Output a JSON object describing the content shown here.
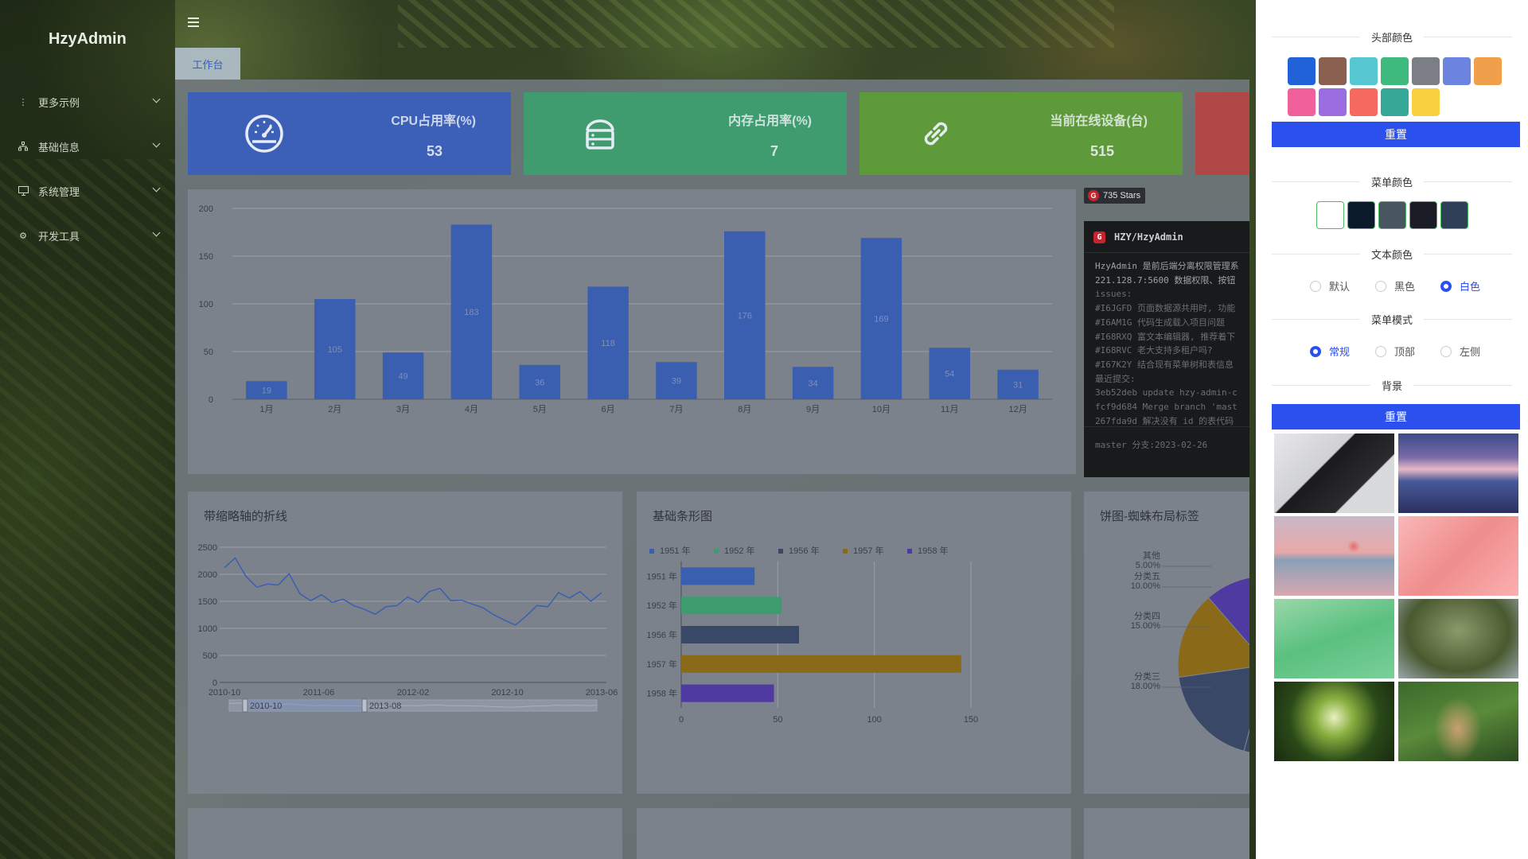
{
  "app": {
    "brand": "HzyAdmin"
  },
  "sidebar": {
    "items": [
      {
        "label": "更多示例",
        "icon": "more-icon"
      },
      {
        "label": "基础信息",
        "icon": "sitemap-icon"
      },
      {
        "label": "系统管理",
        "icon": "desktop-icon"
      },
      {
        "label": "开发工具",
        "icon": "gear-icon"
      }
    ]
  },
  "tabs": [
    {
      "label": "工作台",
      "active": true
    }
  ],
  "stats": [
    {
      "title": "CPU占用率(%)",
      "value": "53",
      "color": "#3c5fb8",
      "icon": "gauge-icon"
    },
    {
      "title": "内存占用率(%)",
      "value": "7",
      "color": "#3f9c6e",
      "icon": "server-icon"
    },
    {
      "title": "当前在线设备(台)",
      "value": "515",
      "color": "#5f9a3a",
      "icon": "link-icon"
    },
    {
      "title": "",
      "value": "",
      "color": "#b04848",
      "icon": ""
    }
  ],
  "bar_chart": {
    "chart_data": {
      "type": "bar",
      "categories": [
        "1月",
        "2月",
        "3月",
        "4月",
        "5月",
        "6月",
        "7月",
        "8月",
        "9月",
        "10月",
        "11月",
        "12月"
      ],
      "values": [
        19,
        105,
        49,
        183,
        36,
        118,
        39,
        176,
        34,
        169,
        54,
        31
      ],
      "ylim": [
        0,
        200
      ],
      "yticks": [
        "0",
        "50",
        "100",
        "150",
        "200"
      ],
      "color": "#3a5fb0"
    }
  },
  "git": {
    "stars": "735 Stars",
    "repo": "HZY/HzyAdmin",
    "lines": [
      "HzyAdmin 是前后端分离权限管理系",
      "221.128.7:5600 数据权限、按钮",
      "issues:",
      "#I6JGFD 页面数据源共用时, 功能",
      "#I6AM1G 代码生成载入项目问题",
      "#I68RXQ 富文本编辑器, 推荐着下",
      "#I68RVC 老大支持多租户吗?",
      "#I67K2Y 结合现有菜单树和表信息",
      "最近提交:",
      "3eb52deb update hzy-admin-c",
      "fcf9d684 Merge branch 'mast",
      "267fda9d 解决没有 id 的表代码"
    ],
    "footer": "master 分支:2023-02-26"
  },
  "line_panel": {
    "title": "带缩略轴的折线",
    "chart_data": {
      "type": "line",
      "x_ticks": [
        "2010-10",
        "2011-06",
        "2012-02",
        "2012-10",
        "2013-06"
      ],
      "ylim": [
        0,
        2500
      ],
      "yticks": [
        "0",
        "500",
        "1000",
        "1500",
        "2000",
        "2500"
      ],
      "values": [
        2120,
        2300,
        1960,
        1760,
        1820,
        1800,
        2010,
        1640,
        1510,
        1620,
        1480,
        1540,
        1420,
        1350,
        1260,
        1400,
        1420,
        1580,
        1480,
        1680,
        1740,
        1510,
        1520,
        1450,
        1380,
        1250,
        1150,
        1060,
        1230,
        1420,
        1400,
        1660,
        1560,
        1680,
        1500,
        1660
      ],
      "dataZoom": {
        "start": "2010-10",
        "end": "2013-08"
      },
      "color": "#3a5fb0"
    }
  },
  "hbar_panel": {
    "title": "基础条形图",
    "chart_data": {
      "type": "bar",
      "orientation": "horizontal",
      "categories": [
        "1951 年",
        "1952 年",
        "1956 年",
        "1957 年",
        "1958 年"
      ],
      "values": [
        38,
        52,
        61,
        145,
        48
      ],
      "colors": [
        "#3a5fb0",
        "#3f9c6e",
        "#3a4868",
        "#8a6a18",
        "#4e3aa0"
      ],
      "legend": [
        "1951 年",
        "1952 年",
        "1956 年",
        "1957 年",
        "1958 年"
      ],
      "xlim": [
        0,
        150
      ],
      "xticks": [
        "0",
        "50",
        "100",
        "150"
      ]
    }
  },
  "pie_panel": {
    "title": "饼图-蜘蛛布局标签",
    "chart_data": {
      "type": "pie",
      "labels": [
        {
          "name": "其他",
          "pct": "5.00%"
        },
        {
          "name": "分类五",
          "pct": "10.00%"
        },
        {
          "name": "分类四",
          "pct": "15.00%"
        },
        {
          "name": "分类三",
          "pct": "18.00%"
        }
      ],
      "colors": [
        "#3a7f9a",
        "#4e3aa0",
        "#8a6a18",
        "#3a4868"
      ]
    }
  },
  "settings": {
    "header_color_title": "头部颜色",
    "header_colors": [
      "#2262d8",
      "#8a6050",
      "#56c6d0",
      "#3fba7e",
      "#7b7f85",
      "#6c84e0",
      "#f0a04a",
      "#f0609a",
      "#9a6ee0",
      "#f56a5e",
      "#36a898",
      "#f8d040"
    ],
    "reset_label": "重置",
    "menu_color_title": "菜单颜色",
    "menu_colors": [
      "#ffffff",
      "#0a1a2a",
      "#4a5562",
      "#1a1d26",
      "#2e3f58"
    ],
    "text_color_title": "文本颜色",
    "text_colors": [
      {
        "label": "默认",
        "on": false
      },
      {
        "label": "黑色",
        "on": false
      },
      {
        "label": "白色",
        "on": true
      }
    ],
    "menu_mode_title": "菜单模式",
    "menu_modes": [
      {
        "label": "常规",
        "on": true
      },
      {
        "label": "顶部",
        "on": false
      },
      {
        "label": "左侧",
        "on": false
      }
    ],
    "bg_title": "背景",
    "bg_reset_label": "重置",
    "backgrounds": [
      "laptop-image",
      "mountain-town-image",
      "pink-sea-image",
      "pink-blossom-image",
      "green-leaf-image",
      "mossy-tree-image",
      "forest-canopy-image",
      "deer-image"
    ]
  }
}
